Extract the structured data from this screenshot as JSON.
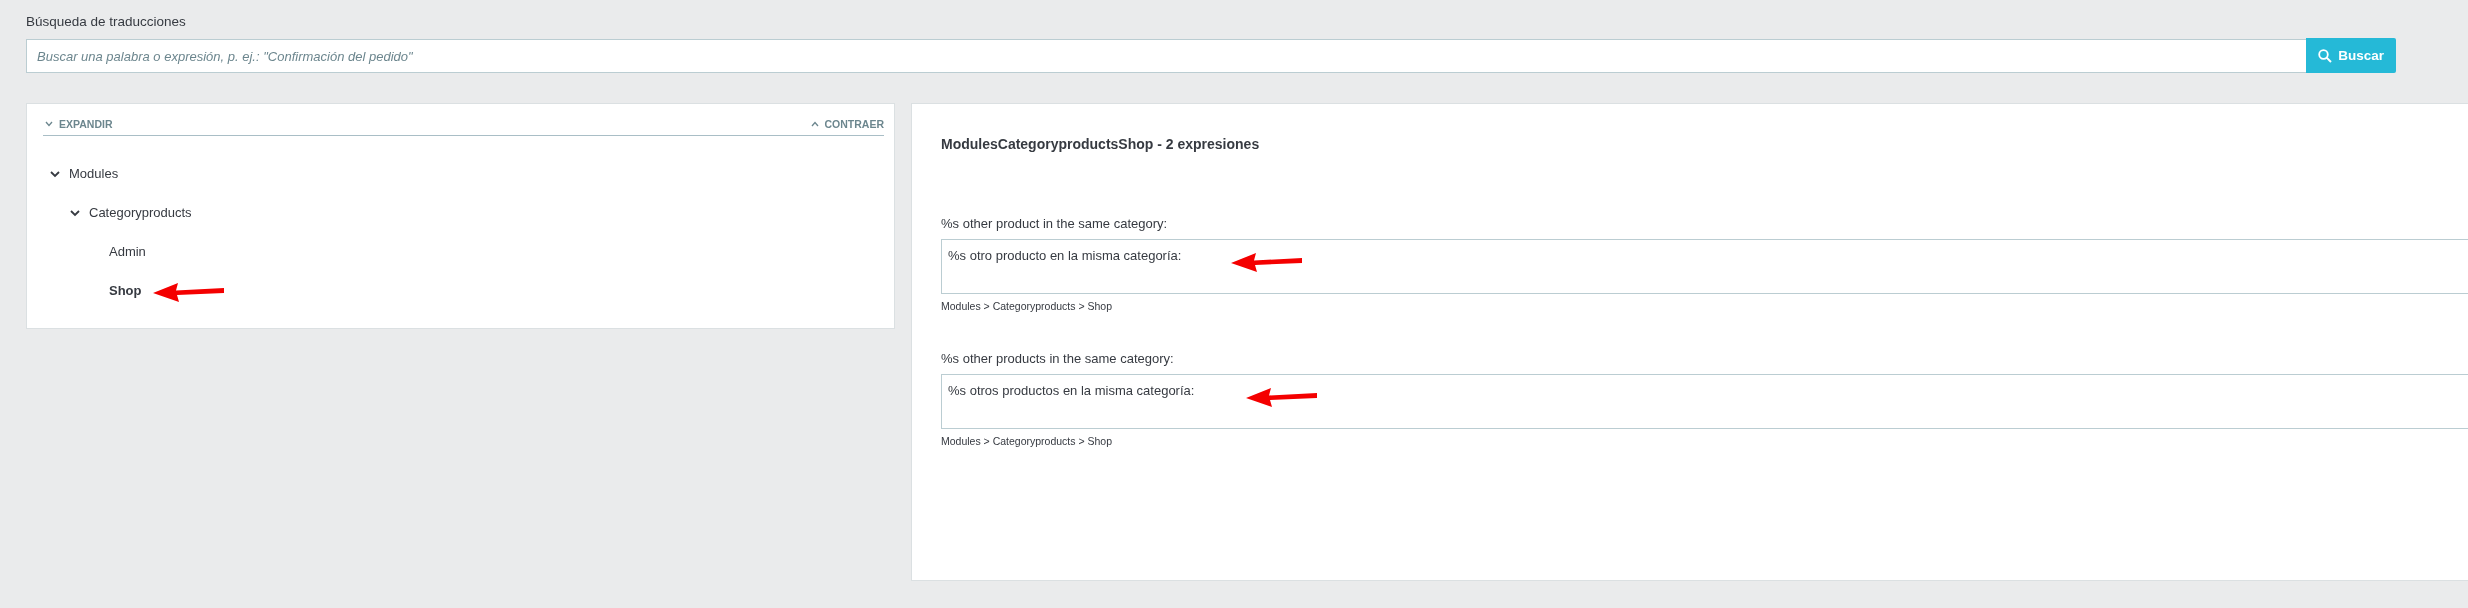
{
  "search": {
    "label": "Búsqueda de traducciones",
    "placeholder": "Buscar una palabra o expresión, p. ej.: \"Confirmación del pedido\"",
    "button": "Buscar"
  },
  "tree": {
    "expand": "EXPANDIR",
    "collapse": "CONTRAER",
    "items": [
      {
        "label": "Modules",
        "expanded": true,
        "selected": false,
        "children": [
          {
            "label": "Categoryproducts",
            "expanded": true,
            "selected": false,
            "children": [
              {
                "label": "Admin",
                "selected": false
              },
              {
                "label": "Shop",
                "selected": true
              }
            ]
          }
        ]
      }
    ]
  },
  "editor": {
    "title": "ModulesCategoryproductsShop - 2 expresiones",
    "entries": [
      {
        "source": "%s other product in the same category:",
        "translation": "%s otro producto en la misma categoría:",
        "path": "Modules > Categoryproducts > Shop"
      },
      {
        "source": "%s other products in the same category:",
        "translation": "%s otros productos en la misma categoría:",
        "path": "Modules > Categoryproducts > Shop"
      }
    ]
  }
}
